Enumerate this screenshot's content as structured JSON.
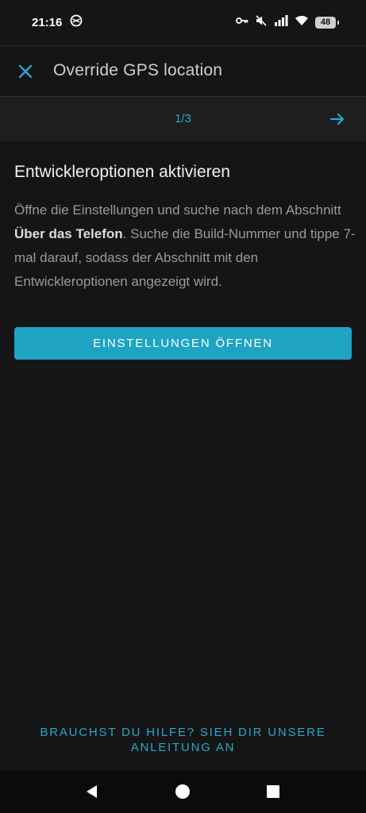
{
  "status_bar": {
    "time": "21:16",
    "battery": "48",
    "icons": [
      "data-saver-icon",
      "vpn-key-icon",
      "mute-icon",
      "signal-icon",
      "wifi-icon",
      "battery-icon"
    ]
  },
  "app_bar": {
    "title": "Override GPS location",
    "close_icon": "close-icon"
  },
  "stepper": {
    "counter": "1/3",
    "next_icon": "arrow-right-icon"
  },
  "step": {
    "heading": "Entwickleroptionen aktivieren",
    "desc_part1": "Öffne die Einstellungen und suche nach dem Abschnitt ",
    "desc_bold": "Über das Telefon",
    "desc_part2": ". Suche die Build-Nummer und tippe 7-mal darauf, sodass der Abschnitt mit den Entwickleroptionen angezeigt wird.",
    "button_label": "EINSTELLUNGEN ÖFFNEN"
  },
  "help": {
    "link_text": "BRAUCHST DU HILFE? SIEH DIR UNSERE ANLEITUNG AN"
  },
  "colors": {
    "accent": "#27a9cc",
    "button": "#1fa3c2",
    "background": "#151515"
  }
}
